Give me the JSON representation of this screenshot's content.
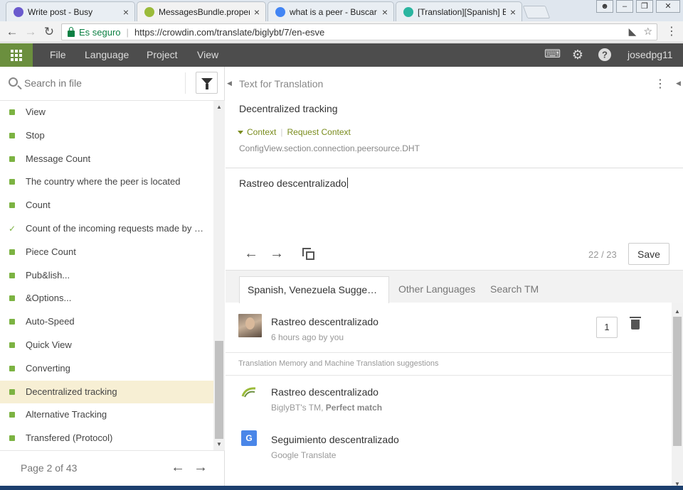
{
  "browser": {
    "tabs": [
      {
        "title": "Write post - Busy",
        "favicon_color": "#6a5acd"
      },
      {
        "title": "MessagesBundle.properties",
        "favicon_color": "#9bbb3a"
      },
      {
        "title": "what is a peer - Buscar con Google",
        "favicon_color": "#4285f4"
      },
      {
        "title": "[Translation][Spanish] BiglyBT",
        "favicon_color": "#2bb5a0"
      }
    ],
    "secure_label": "Es seguro",
    "url": "https://crowdin.com/translate/biglybt/7/en-esve"
  },
  "app": {
    "menu": [
      "File",
      "Language",
      "Project",
      "View"
    ],
    "username": "josedpg11",
    "accent": "#6b8f3e"
  },
  "left": {
    "search_placeholder": "Search in file",
    "strings": [
      {
        "text": "View",
        "state": "translated"
      },
      {
        "text": "Stop",
        "state": "translated"
      },
      {
        "text": "Message Count",
        "state": "translated"
      },
      {
        "text": "The country where the peer is located",
        "state": "translated"
      },
      {
        "text": "Count",
        "state": "translated"
      },
      {
        "text": "Count of the incoming requests made by peers",
        "state": "approved"
      },
      {
        "text": "Piece Count",
        "state": "translated"
      },
      {
        "text": "Pub&lish...",
        "state": "translated"
      },
      {
        "text": "&Options...",
        "state": "translated"
      },
      {
        "text": "Auto-Speed",
        "state": "translated"
      },
      {
        "text": "Quick View",
        "state": "translated"
      },
      {
        "text": "Converting",
        "state": "translated"
      },
      {
        "text": "Decentralized tracking",
        "state": "translated",
        "selected": true
      },
      {
        "text": "Alternative Tracking",
        "state": "translated"
      },
      {
        "text": "Transfered (Protocol)",
        "state": "translated"
      }
    ],
    "page_text": "Page 2 of 43"
  },
  "editor": {
    "source_label": "Text for Translation",
    "source_text": "Decentralized tracking",
    "context_label": "Context",
    "request_context_label": "Request Context",
    "context_value": "ConfigView.section.connection.peersource.DHT",
    "translation_text": "Rastreo descentralizado",
    "counter": "22 / 23",
    "save_label": "Save"
  },
  "suggestions": {
    "tabs": [
      "Spanish, Venezuela Suggestions",
      "Other Languages",
      "Search TM"
    ],
    "active_tab": 0,
    "user_suggestion": {
      "text": "Rastreo descentralizado",
      "meta": "6 hours ago by you",
      "votes": "1"
    },
    "tm_header": "Translation Memory and Machine Translation suggestions",
    "tm_items": [
      {
        "text": "Rastreo descentralizado",
        "source": "BiglyBT's TM,",
        "match": "Perfect match"
      },
      {
        "text": "Seguimiento descentralizado",
        "source": "Google Translate",
        "match": ""
      }
    ]
  }
}
